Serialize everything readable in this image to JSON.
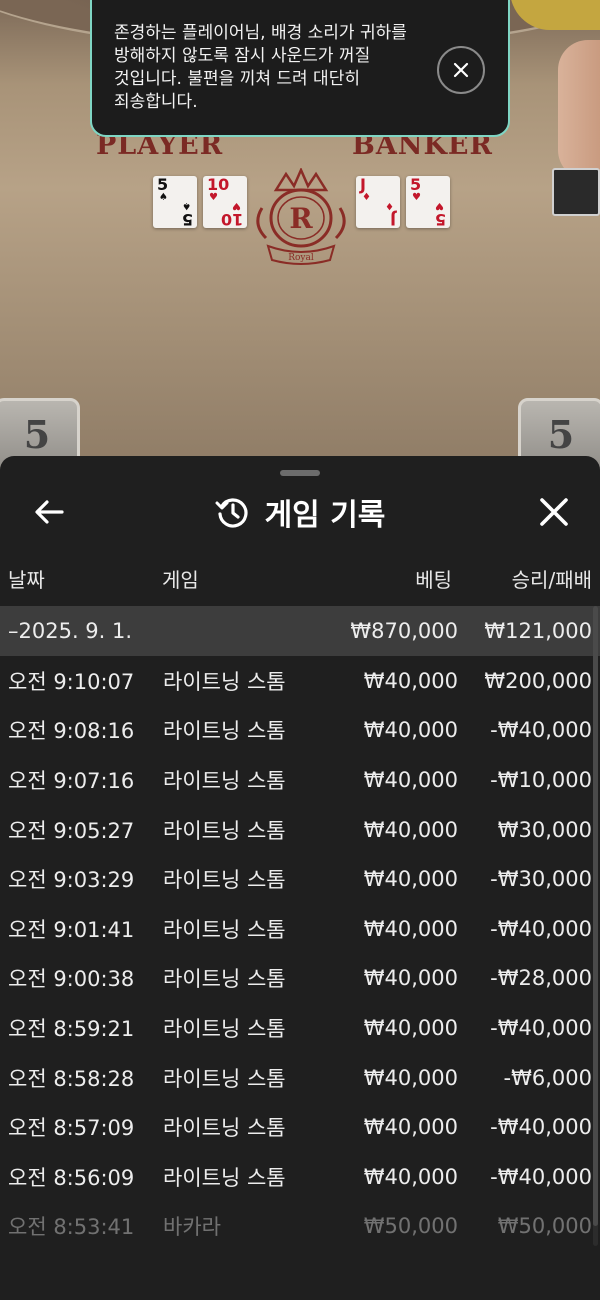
{
  "table": {
    "player_label": "PLAYER",
    "banker_label": "BANKER",
    "emblem_letter": "R",
    "emblem_word": "Royal",
    "player_cards": [
      {
        "rank": "5",
        "suit": "♠",
        "color": "black"
      },
      {
        "rank": "10",
        "suit": "♥",
        "color": "red"
      }
    ],
    "banker_cards": [
      {
        "rank": "J",
        "suit": "♦",
        "color": "red"
      },
      {
        "rank": "5",
        "suit": "♥",
        "color": "red"
      }
    ],
    "player_score": "5",
    "banker_score": "5"
  },
  "toast": {
    "message": "존경하는 플레이어님, 배경 소리가 귀하를 방해하지 않도록 잠시 사운드가 꺼질 것입니다. 불편을 끼쳐 드려 대단히 죄송합니다.",
    "accent_color": "#7fd6c4",
    "close_icon": "close-icon"
  },
  "history": {
    "title": "게임 기록",
    "title_icon": "history-icon",
    "back_icon": "arrow-left-icon",
    "close_icon": "close-icon",
    "columns": {
      "date": "날짜",
      "game": "게임",
      "bet": "베팅",
      "result": "승리/패배"
    },
    "summary": {
      "date": "–2025. 9. 1.",
      "bet": "₩870,000",
      "result": "₩121,000"
    },
    "rows": [
      {
        "time": "오전 9:10:07",
        "game": "라이트닝 스톰",
        "bet": "₩40,000",
        "result": "₩200,000"
      },
      {
        "time": "오전 9:08:16",
        "game": "라이트닝 스톰",
        "bet": "₩40,000",
        "result": "-₩40,000"
      },
      {
        "time": "오전 9:07:16",
        "game": "라이트닝 스톰",
        "bet": "₩40,000",
        "result": "-₩10,000"
      },
      {
        "time": "오전 9:05:27",
        "game": "라이트닝 스톰",
        "bet": "₩40,000",
        "result": "₩30,000"
      },
      {
        "time": "오전 9:03:29",
        "game": "라이트닝 스톰",
        "bet": "₩40,000",
        "result": "-₩30,000"
      },
      {
        "time": "오전 9:01:41",
        "game": "라이트닝 스톰",
        "bet": "₩40,000",
        "result": "-₩40,000"
      },
      {
        "time": "오전 9:00:38",
        "game": "라이트닝 스톰",
        "bet": "₩40,000",
        "result": "-₩28,000"
      },
      {
        "time": "오전 8:59:21",
        "game": "라이트닝 스톰",
        "bet": "₩40,000",
        "result": "-₩40,000"
      },
      {
        "time": "오전 8:58:28",
        "game": "라이트닝 스톰",
        "bet": "₩40,000",
        "result": "-₩6,000"
      },
      {
        "time": "오전 8:57:09",
        "game": "라이트닝 스톰",
        "bet": "₩40,000",
        "result": "-₩40,000"
      },
      {
        "time": "오전 8:56:09",
        "game": "라이트닝 스톰",
        "bet": "₩40,000",
        "result": "-₩40,000"
      },
      {
        "time": "오전 8:53:41",
        "game": "바카라",
        "bet": "₩50,000",
        "result": "₩50,000"
      }
    ]
  }
}
